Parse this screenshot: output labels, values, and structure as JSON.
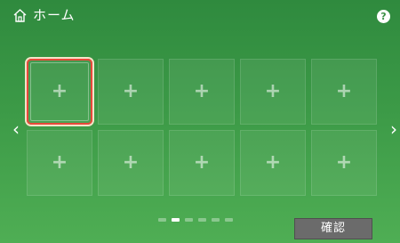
{
  "header": {
    "title": "ホーム",
    "home_icon": "home-icon",
    "help_label": "?"
  },
  "grid": {
    "rows": 2,
    "columns": 5,
    "selected_index": 0,
    "tiles": [
      {
        "label": "+"
      },
      {
        "label": "+"
      },
      {
        "label": "+"
      },
      {
        "label": "+"
      },
      {
        "label": "+"
      },
      {
        "label": "+"
      },
      {
        "label": "+"
      },
      {
        "label": "+"
      },
      {
        "label": "+"
      },
      {
        "label": "+"
      }
    ]
  },
  "navigation": {
    "prev_icon": "chevron-left-icon",
    "next_icon": "chevron-right-icon",
    "prev_glyph": "‹",
    "next_glyph": "›"
  },
  "pager": {
    "page_count": 6,
    "current_page": 2
  },
  "footer": {
    "confirm_label": "確認"
  },
  "colors": {
    "background_top": "#2f8a3e",
    "background_bottom": "#4fae54",
    "selection_border": "#e8483a",
    "confirm_button": "#6b6b6b"
  }
}
